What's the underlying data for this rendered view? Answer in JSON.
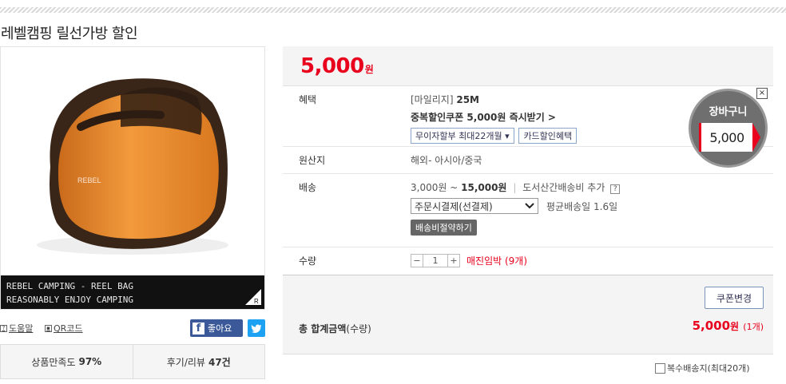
{
  "title": "레벨캠핑 릴선가방 할인",
  "image": {
    "caption_line1": "REBEL CAMPING - REEL BAG",
    "caption_line2": "REASONABLY ENJOY CAMPING"
  },
  "tools": {
    "help": "도움말",
    "qr": "QR코드",
    "like": "좋아요"
  },
  "stats": {
    "satisfaction_label": "상품만족도",
    "satisfaction_value": "97%",
    "review_label": "후기/리뷰",
    "review_value": "47건"
  },
  "price": {
    "amount": "5,000",
    "unit": "원"
  },
  "benefit": {
    "label": "혜택",
    "mileage_label": "[마일리지]",
    "mileage_value": "25M",
    "coupon_text": "중복할인쿠폰 5,000원 즉시받기 >",
    "installment_btn": "무이자할부 최대22개월",
    "card_btn": "카드할인혜택"
  },
  "origin": {
    "label": "원산지",
    "value": "해외- 아시아/중국"
  },
  "delivery": {
    "label": "배송",
    "fee_from": "3,000원",
    "tilde": "~",
    "fee_to": "15,000원",
    "separator": "|",
    "extra": "도서산간배송비 추가",
    "method_selected": "주문시결제(선결제)",
    "avg_days": "평균배송일 1.6일",
    "save_btn": "배송비절약하기"
  },
  "quantity": {
    "label": "수량",
    "minus": "−",
    "value": "1",
    "plus": "+",
    "warning": "매진임박 (9개)"
  },
  "total": {
    "coupon_change": "쿠폰변경",
    "label_bold": "총 합계금액",
    "label_rest": "(수량)",
    "amount": "5,000",
    "unit": "원",
    "count": "(1개)"
  },
  "multi_address": "복수배송지(최대20개)",
  "cart": {
    "label": "장바구니",
    "price": "5,000",
    "close": "×"
  },
  "colors": {
    "accent": "#e8001c",
    "facebook": "#3b5998",
    "twitter": "#1da1f2"
  }
}
